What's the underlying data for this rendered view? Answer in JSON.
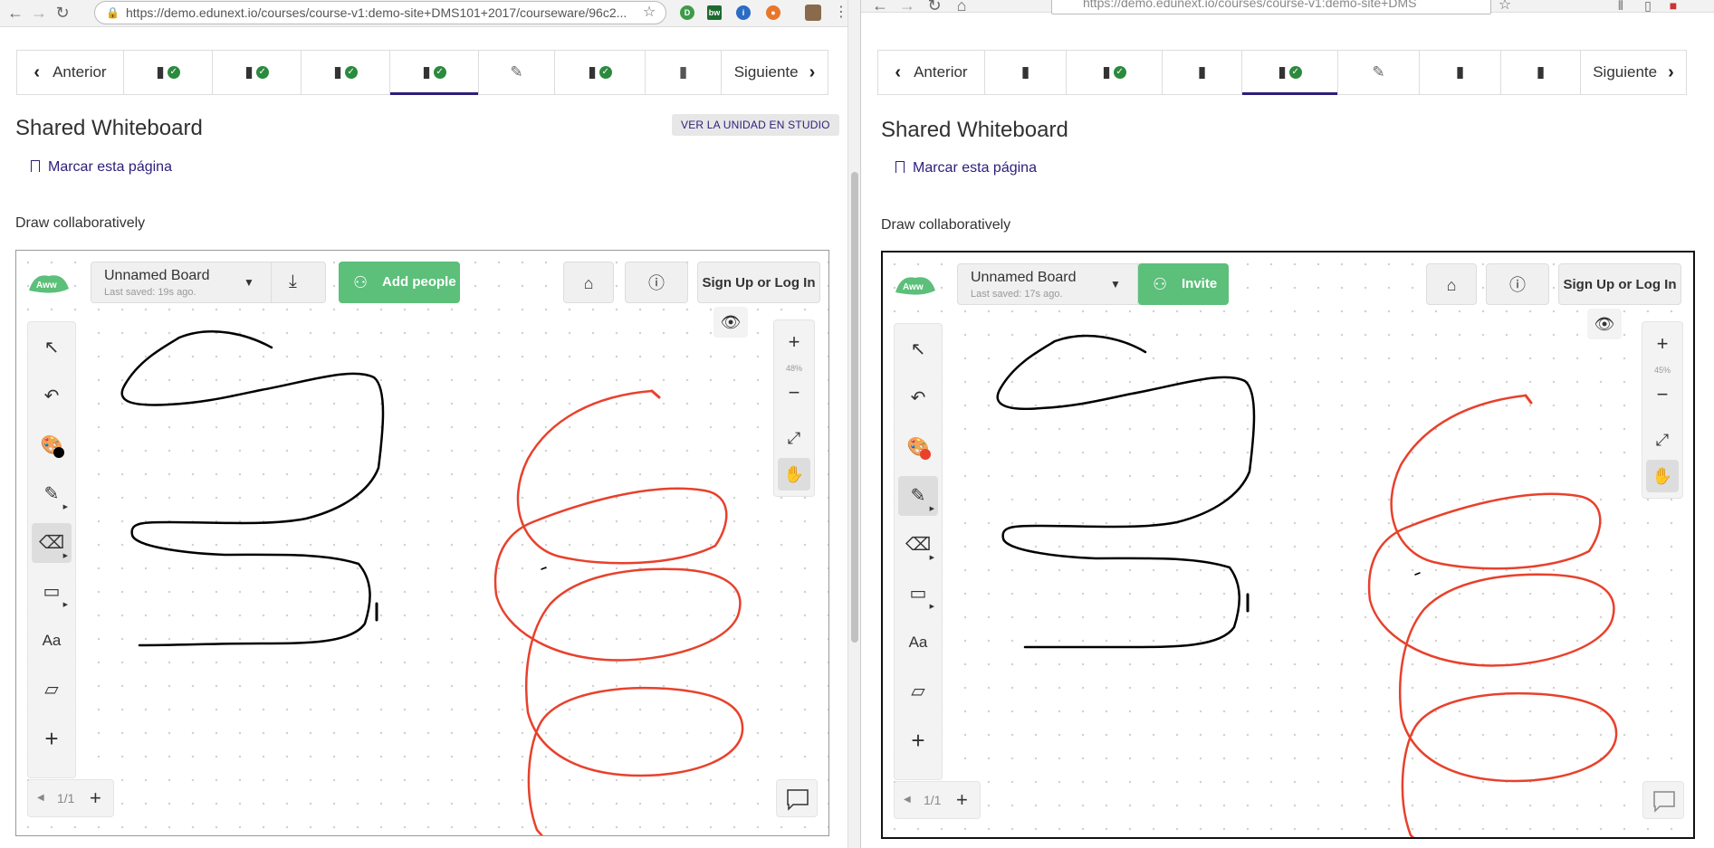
{
  "left": {
    "url": "https://demo.edunext.io/courses/course-v1:demo-site+DMS101+2017/courseware/96c2...",
    "url_host": "demo.edunext.io",
    "nav": {
      "prev": "Anterior",
      "next": "Siguiente"
    },
    "unit_title": "Shared Whiteboard",
    "studio_button": "VER LA UNIDAD EN STUDIO",
    "bookmark": "Marcar esta página",
    "description": "Draw collaboratively",
    "board": {
      "name": "Unnamed Board",
      "saved": "Last saved: 19s ago.",
      "invite_label": "Add people",
      "login": "Sign Up or Log In",
      "zoom": "48%",
      "page": "1/1",
      "color": "#000000"
    }
  },
  "right": {
    "url": "https://demo.edunext.io/courses/course-v1:demo-site+DMS",
    "nav": {
      "prev": "Anterior",
      "next": "Siguiente"
    },
    "unit_title": "Shared Whiteboard",
    "bookmark": "Marcar esta página",
    "description": "Draw collaboratively",
    "board": {
      "name": "Unnamed Board",
      "saved": "Last saved: 17s ago.",
      "invite_label": "Invite",
      "login": "Sign Up or Log In",
      "zoom": "45%",
      "page": "1/1",
      "color": "#e8412c"
    }
  },
  "colors": {
    "accent": "#2c1e7a",
    "green": "#5cbf7a",
    "stroke_black": "#000000",
    "stroke_red": "#e8412c"
  },
  "icons": [
    "back-icon",
    "forward-icon",
    "reload-icon",
    "lock-icon",
    "star-icon",
    "book-icon",
    "check-icon",
    "edit-icon",
    "download-icon",
    "people-icon",
    "home-icon",
    "info-icon",
    "cursor-icon",
    "undo-icon",
    "palette-icon",
    "pencil-icon",
    "eraser-icon",
    "rectangle-icon",
    "text-icon",
    "sticky-note-icon",
    "plus-icon",
    "eye-icon",
    "zoom-in-icon",
    "zoom-out-icon",
    "fullscreen-icon",
    "hand-icon",
    "chat-icon"
  ]
}
